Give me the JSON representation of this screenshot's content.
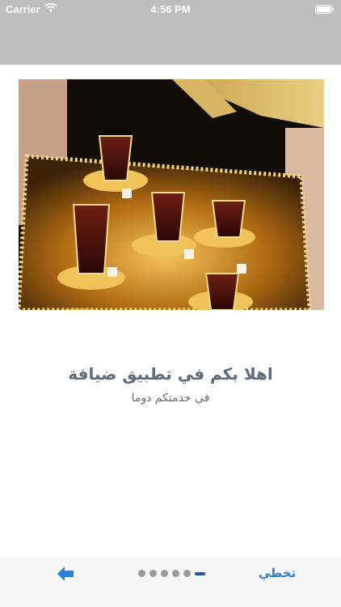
{
  "status_bar": {
    "carrier": "Carrier",
    "time": "4:56 PM",
    "icons": [
      "wifi-icon",
      "battery-icon"
    ]
  },
  "hero": {
    "description_icon": "tea-glasses-photo"
  },
  "onboarding": {
    "title": "اهلا بكم في تطبيق ضيافة",
    "subtitle": "في خدمتكم دوما"
  },
  "bottom_bar": {
    "skip_label": "تخطي",
    "next_icon": "arrow-left-icon",
    "page_count": 6,
    "active_page": 6
  },
  "colors": {
    "status_bar_bg": "#bdbdbd",
    "title": "#5c6b7c",
    "accent_blue": "#2f7fd6",
    "active_dot": "#2e4ea0",
    "inactive_dot": "#9a9a9a"
  }
}
